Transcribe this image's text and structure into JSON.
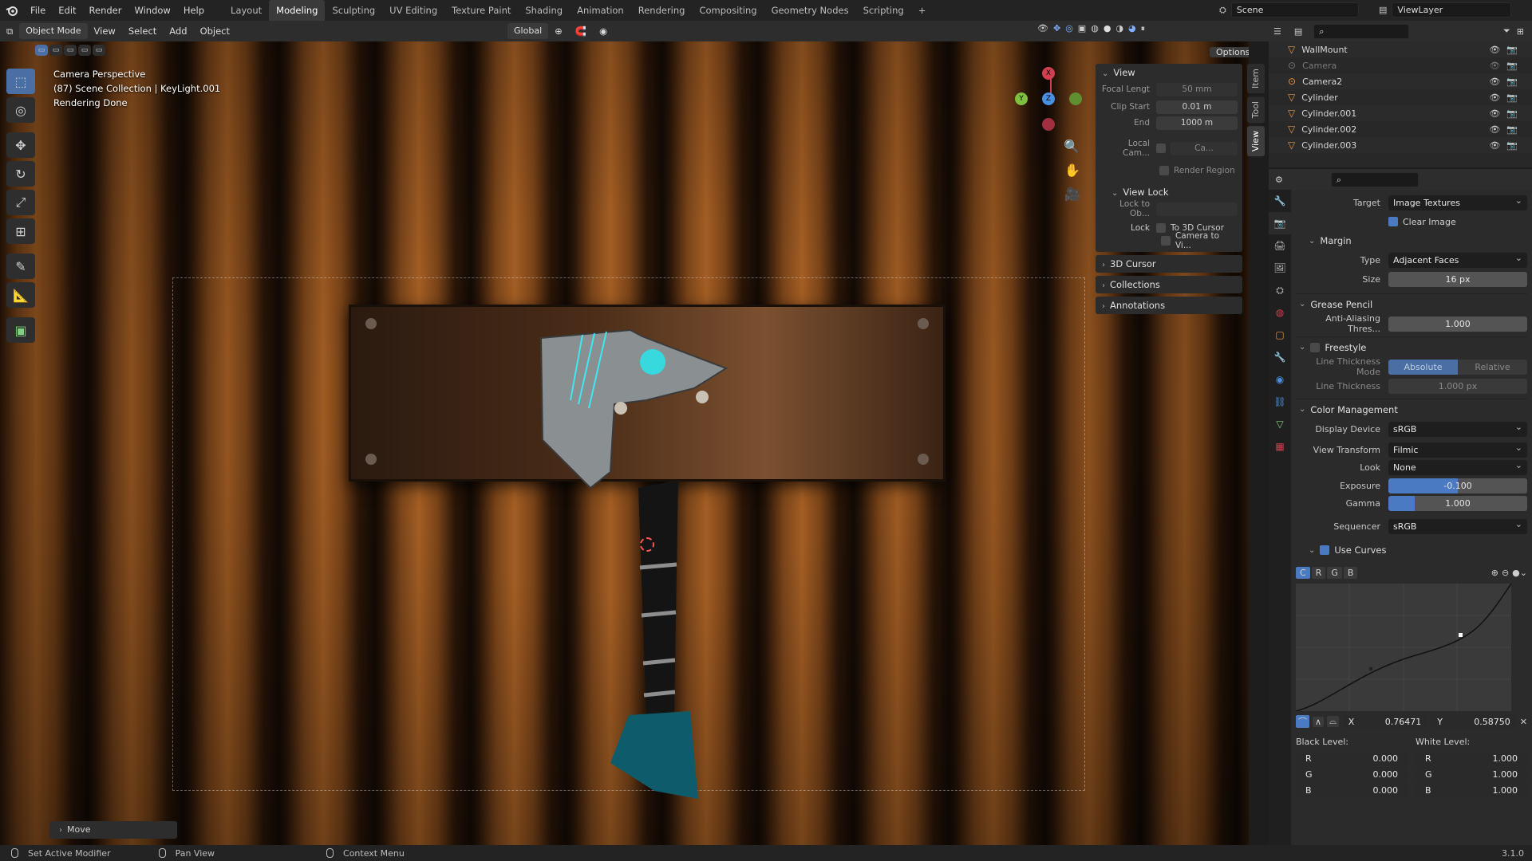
{
  "menu": {
    "file": "File",
    "edit": "Edit",
    "render": "Render",
    "window": "Window",
    "help": "Help"
  },
  "workspaces": [
    "Layout",
    "Modeling",
    "Sculpting",
    "UV Editing",
    "Texture Paint",
    "Shading",
    "Animation",
    "Rendering",
    "Compositing",
    "Geometry Nodes",
    "Scripting"
  ],
  "active_workspace_index": 1,
  "scene": {
    "name": "Scene",
    "view_layer": "ViewLayer"
  },
  "viewport_header": {
    "mode": "Object Mode",
    "view": "View",
    "select": "Select",
    "add": "Add",
    "object": "Object",
    "orientation": "Global",
    "options": "Options"
  },
  "viewport_overlay": {
    "line1": "Camera Perspective",
    "line2": "(87) Scene Collection | KeyLight.001",
    "line3": "Rendering Done"
  },
  "gizmo": {
    "x": "X",
    "y": "Y",
    "z": "Z"
  },
  "npanel": {
    "view_title": "View",
    "focal_length_label": "Focal Lengt",
    "focal_length_value": "50 mm",
    "clip_start_label": "Clip Start",
    "clip_start_value": "0.01 m",
    "end_label": "End",
    "end_value": "1000 m",
    "local_cam_label": "Local Cam...",
    "local_cam_value": "Ca...",
    "render_region": "Render Region",
    "view_lock_title": "View Lock",
    "lock_to_obj_label": "Lock to Ob...",
    "lock_label": "Lock",
    "to_3d_cursor": "To 3D Cursor",
    "camera_to_view": "Camera to Vi...",
    "cursor_3d": "3D Cursor",
    "collections": "Collections",
    "annotations": "Annotations"
  },
  "vtabs": {
    "item": "Item",
    "tool": "Tool",
    "view": "View"
  },
  "bottom_panel": {
    "move": "Move"
  },
  "outliner": {
    "rows": [
      {
        "name": "WallMount"
      },
      {
        "name": "Camera"
      },
      {
        "name": "Camera2"
      },
      {
        "name": "Cylinder"
      },
      {
        "name": "Cylinder.001"
      },
      {
        "name": "Cylinder.002"
      },
      {
        "name": "Cylinder.003"
      }
    ]
  },
  "props": {
    "target_label": "Target",
    "target_value": "Image Textures",
    "clear_image": "Clear Image",
    "margin_title": "Margin",
    "type_label": "Type",
    "type_value": "Adjacent Faces",
    "size_label": "Size",
    "size_value": "16 px",
    "grease_pencil_title": "Grease Pencil",
    "anti_alias_label": "Anti-Aliasing Thres...",
    "anti_alias_value": "1.000",
    "freestyle_title": "Freestyle",
    "line_thickness_mode_label": "Line Thickness Mode",
    "absolute": "Absolute",
    "relative": "Relative",
    "line_thickness_label": "Line Thickness",
    "line_thickness_value": "1.000 px",
    "color_mgmt_title": "Color Management",
    "display_device_label": "Display Device",
    "display_device_value": "sRGB",
    "view_transform_label": "View Transform",
    "view_transform_value": "Filmic",
    "look_label": "Look",
    "look_value": "None",
    "exposure_label": "Exposure",
    "exposure_value": "-0.100",
    "gamma_label": "Gamma",
    "gamma_value": "1.000",
    "sequencer_label": "Sequencer",
    "sequencer_value": "sRGB",
    "use_curves": "Use Curves",
    "curve_tabs": [
      "C",
      "R",
      "G",
      "B"
    ],
    "x_label": "X",
    "x_value": "0.76471",
    "y_label": "Y",
    "y_value": "0.58750",
    "black_level": "Black Level:",
    "white_level": "White Level:",
    "r": "R",
    "g": "G",
    "b": "B",
    "black_r": "0.000",
    "black_g": "0.000",
    "black_b": "0.000",
    "white_r": "1.000",
    "white_g": "1.000",
    "white_b": "1.000"
  },
  "status": {
    "set_active_modifier": "Set Active Modifier",
    "pan_view": "Pan View",
    "context_menu": "Context Menu",
    "version": "3.1.0"
  }
}
